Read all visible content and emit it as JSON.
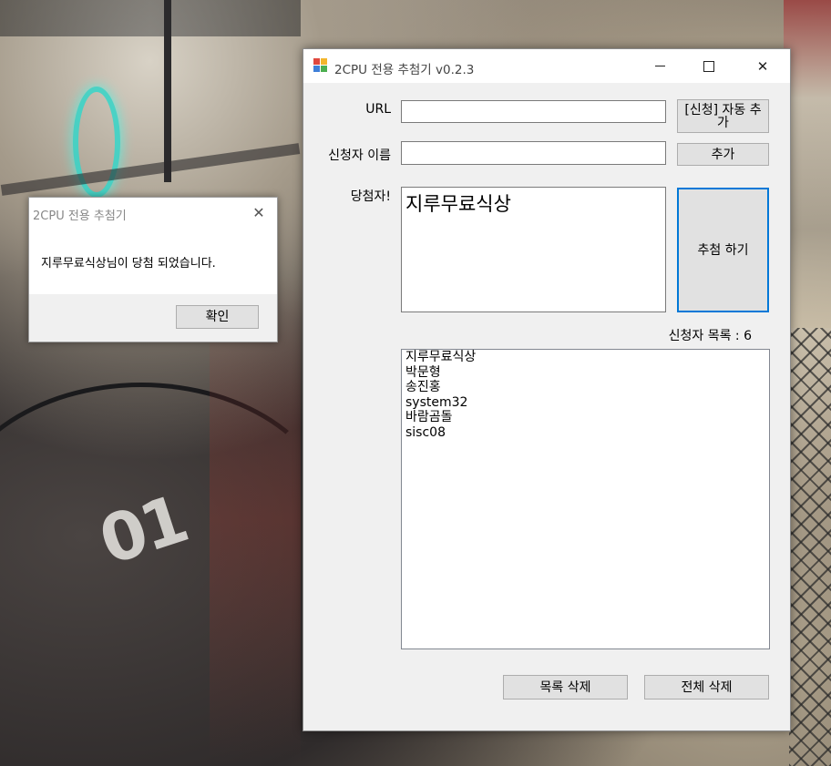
{
  "window": {
    "title": "2CPU 전용 추첨기 v0.2.3",
    "close_glyph": "✕"
  },
  "form": {
    "url_label": "URL",
    "url_value": "",
    "auto_add_label": "[신청] 자동 추가",
    "applicant_label": "신청자 이름",
    "applicant_value": "",
    "add_label": "추가",
    "winner_label": "당첨자!",
    "winner_value": "지루무료식상",
    "draw_label": "추첨 하기",
    "count_label": "신청자 목록 : 6",
    "applicants": [
      "지루무료식상",
      "박문형",
      "송진홍",
      "system32",
      "바람곰돌",
      "sisc08"
    ],
    "delete_list_label": "목록 삭제",
    "delete_all_label": "전체 삭제"
  },
  "dialog": {
    "title": "2CPU 전용 추첨기",
    "message": "지루무료식상님이 당첨 되었습니다.",
    "ok_label": "확인",
    "close_glyph": "✕"
  },
  "icons": {
    "app": "app-icon",
    "minimize": "minimize-icon",
    "maximize": "maximize-icon",
    "close": "close-icon"
  },
  "colors": {
    "focus_border": "#0078d7",
    "button_face": "#e1e1e1",
    "window_bg": "#f0f0f0"
  }
}
